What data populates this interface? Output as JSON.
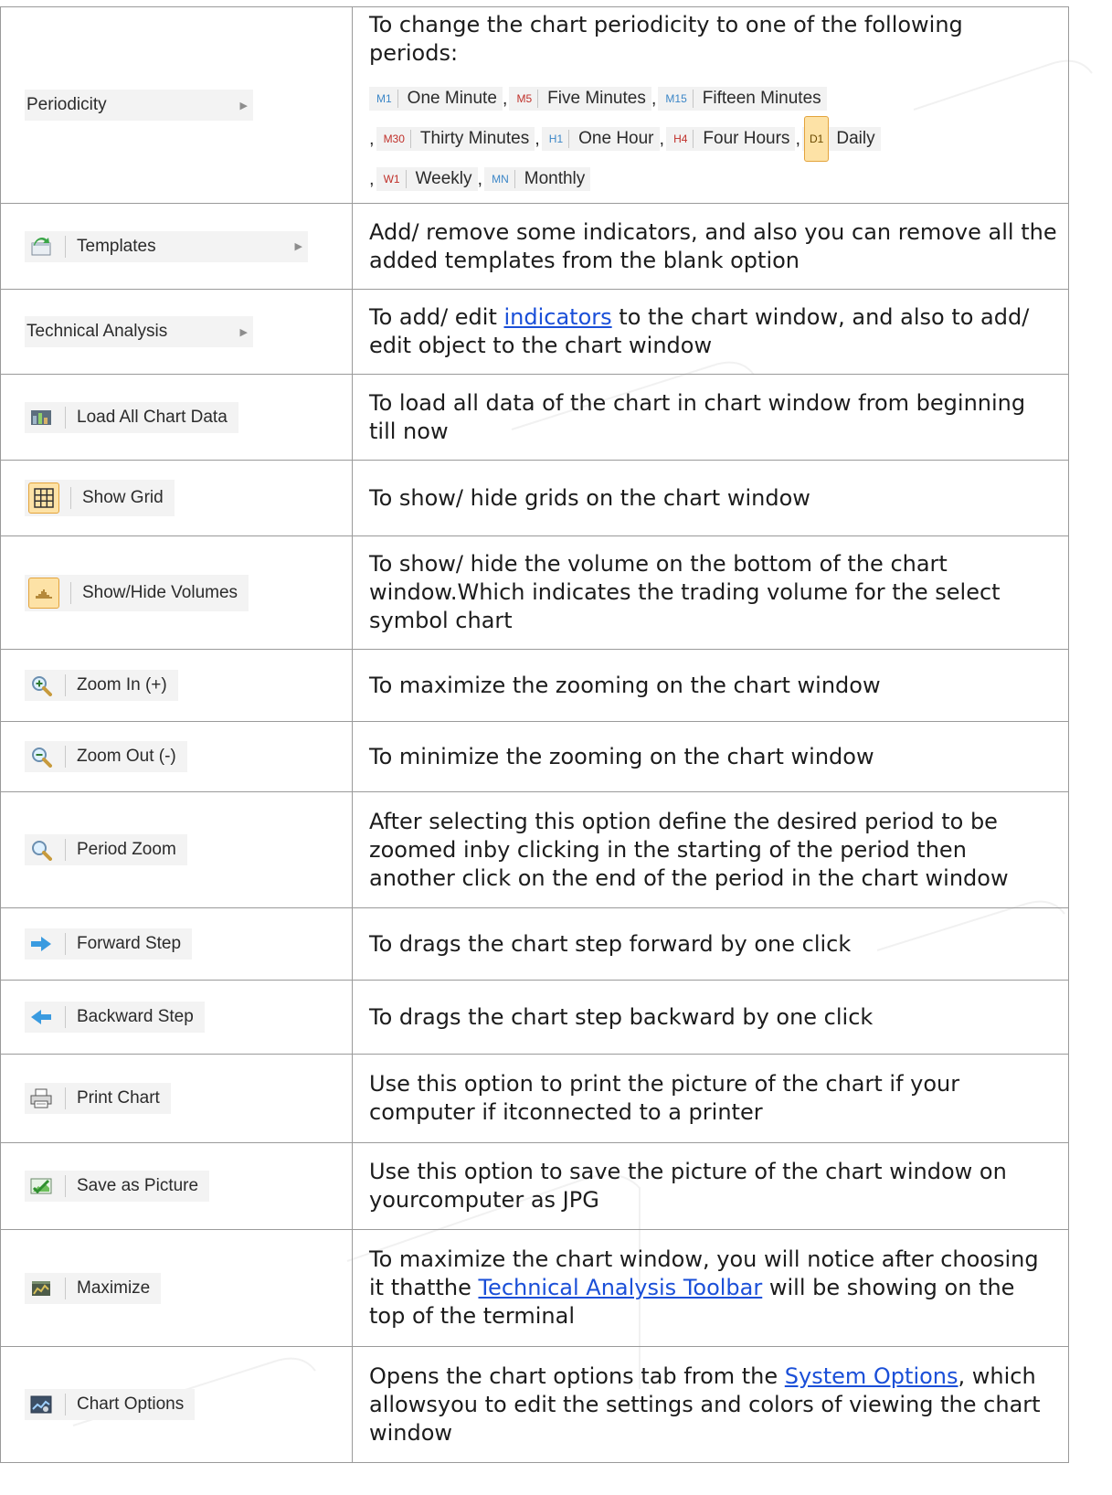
{
  "rows": [
    {
      "label": "Periodicity",
      "icon": "none",
      "arrow": true,
      "desc": "To change the chart periodicity to one of the following periods:",
      "periods": [
        {
          "code": "M1",
          "name": "One Minute",
          "color": "#3b86c7"
        },
        {
          "code": "M5",
          "name": "Five Minutes",
          "color": "#c0302a"
        },
        {
          "code": "M15",
          "name": "Fifteen Minutes",
          "color": "#3b86c7"
        },
        {
          "code": "M30",
          "name": "Thirty Minutes",
          "color": "#c0302a"
        },
        {
          "code": "H1",
          "name": "One Hour",
          "color": "#3b86c7"
        },
        {
          "code": "H4",
          "name": "Four Hours",
          "color": "#c0302a"
        },
        {
          "code": "D1",
          "name": "Daily",
          "color": "#6b4a00"
        },
        {
          "code": "W1",
          "name": "Weekly",
          "color": "#c0302a"
        },
        {
          "code": "MN",
          "name": "Monthly",
          "color": "#3b86c7"
        }
      ],
      "comma": ","
    },
    {
      "label": "Templates",
      "icon": "templates-icon",
      "arrow": true,
      "desc": "Add/ remove some indicators, and also you can remove all the added templates from the blank option"
    },
    {
      "label": "Technical Analysis",
      "icon": "none",
      "arrow": true,
      "desc_before": "To add/ edit ",
      "link": "indicators",
      "desc_after": " to the chart window, and also to add/ edit object to the chart window"
    },
    {
      "label": "Load All Chart Data",
      "icon": "load-chart-data-icon",
      "desc": "To load all data of the chart in chart window from beginning till now"
    },
    {
      "label": "Show Grid",
      "icon": "grid-icon",
      "desc": "To show/ hide grids on the chart window"
    },
    {
      "label": "Show/Hide Volumes",
      "icon": "volumes-icon",
      "desc": "To show/ hide the volume on the bottom of the chart window.Which indicates the trading volume for the select symbol chart"
    },
    {
      "label": "Zoom In (+)",
      "icon": "zoom-in-icon",
      "desc": "To maximize the zooming on the chart window"
    },
    {
      "label": "Zoom Out (-)",
      "icon": "zoom-out-icon",
      "desc": "To minimize the zooming on the chart window"
    },
    {
      "label": "Period Zoom",
      "icon": "period-zoom-icon",
      "desc": "After selecting this option define the desired period to be zoomed inby clicking in the starting of the period then another click on the end of the period in the chart window"
    },
    {
      "label": "Forward Step",
      "icon": "forward-arrow-icon",
      "desc": "To drags the chart step forward by one click"
    },
    {
      "label": "Backward Step",
      "icon": "backward-arrow-icon",
      "desc": "To drags the chart step backward by one click"
    },
    {
      "label": "Print Chart",
      "icon": "printer-icon",
      "desc": "Use this option to print the picture of the chart if your computer if itconnected to a printer"
    },
    {
      "label": "Save as Picture",
      "icon": "save-picture-icon",
      "desc": "Use this option to save the picture of the chart window on yourcomputer as JPG"
    },
    {
      "label": "Maximize",
      "icon": "maximize-icon",
      "desc_before": "To maximize the chart window, you will notice after choosing it thatthe ",
      "link": "Technical Analysis Toolbar",
      "desc_after": " will be showing on the top of the terminal"
    },
    {
      "label": "Chart Options",
      "icon": "chart-options-icon",
      "desc_before": "Opens the chart options tab from the ",
      "link": "System Options",
      "desc_after": ", which allowsyou to edit the settings and colors of viewing the chart window"
    }
  ]
}
